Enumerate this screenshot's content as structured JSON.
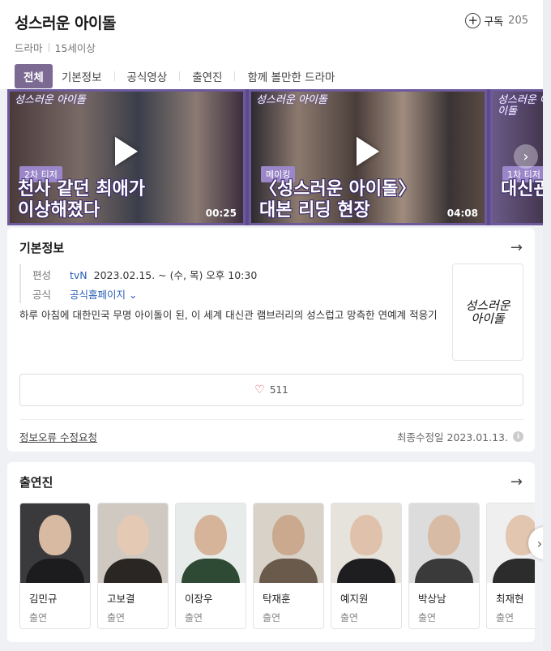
{
  "header": {
    "title": "성스러운 아이돌",
    "genre": "드라마",
    "rating": "15세이상",
    "subscribe_label": "구독",
    "subscribe_count": "205"
  },
  "tabs": [
    "전체",
    "기본정보",
    "공식영상",
    "출연진",
    "함께 볼만한 드라마"
  ],
  "videos": [
    {
      "logo": "성스러운 아이돌",
      "tag": "2차 티저",
      "caption_line1": "천사 같던 최애가",
      "caption_line2": "이상해졌다",
      "duration": "00:25"
    },
    {
      "logo": "성스러운 아이돌",
      "tag": "메이킹",
      "caption_line1": "〈성스러운 아이돌〉",
      "caption_line2": "대본 리딩 현장",
      "duration": "04:08"
    },
    {
      "logo": "성스러운 아이돌",
      "tag": "1차 티저",
      "caption_line1": "",
      "caption_line2": "대신관",
      "duration": ""
    }
  ],
  "info": {
    "title": "기본정보",
    "schedule_label": "편성",
    "network": "tvN",
    "schedule": "2023.02.15. ~  (수, 목) 오후 10:30",
    "official_label": "공식",
    "official_link": "공식홈페이지",
    "description": "하루 아침에 대한민국 무명 아이돌이 된, 이 세계 대신관 램브러리의 성스럽고 망측한 연예계 적응기",
    "poster_text_1": "성스러운",
    "poster_text_2": "아이돌",
    "likes": "511",
    "report_label": "정보오류 수정요청",
    "updated": "최종수정일 2023.01.13."
  },
  "cast": {
    "title": "출연진",
    "people": [
      {
        "name": "김민규",
        "role": "출연"
      },
      {
        "name": "고보결",
        "role": "출연"
      },
      {
        "name": "이장우",
        "role": "출연"
      },
      {
        "name": "탁재훈",
        "role": "출연"
      },
      {
        "name": "예지원",
        "role": "출연"
      },
      {
        "name": "박상남",
        "role": "출연"
      },
      {
        "name": "최재현",
        "role": "출연"
      }
    ]
  },
  "colors": {
    "accent": "#7c6a93",
    "video_frame": "#5d4a8c",
    "link": "#2a5fb8",
    "heart": "#e0445a"
  }
}
